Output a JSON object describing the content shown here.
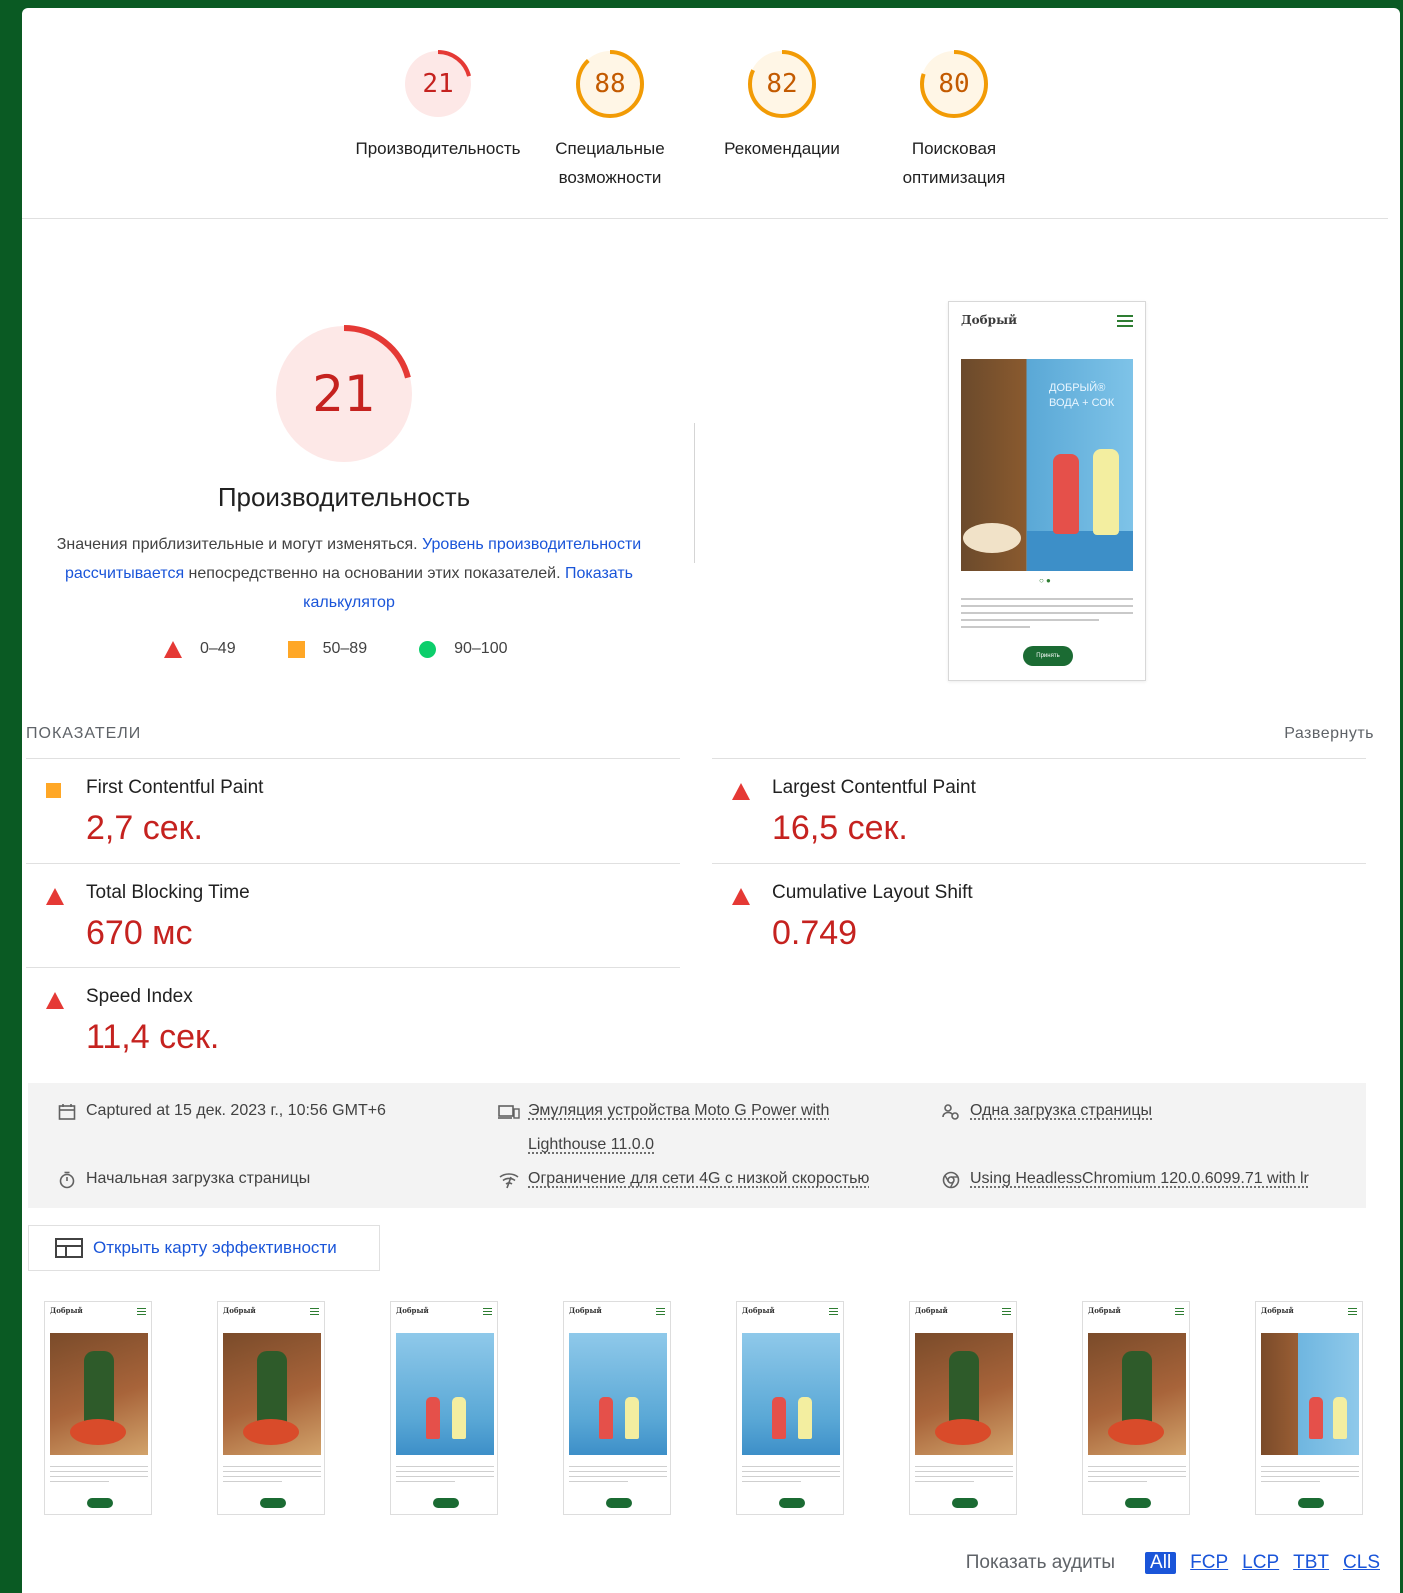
{
  "colors": {
    "fail": "#c5221f",
    "average": "#e67700",
    "pass": "#0cce6b",
    "link": "#1a55d9",
    "brand": "#0a5a23"
  },
  "gauges": [
    {
      "score": 21,
      "label": "Производительность",
      "status": "fail"
    },
    {
      "score": 88,
      "label": "Специальные возможности",
      "status": "average"
    },
    {
      "score": 82,
      "label": "Рекомендации",
      "status": "average"
    },
    {
      "score": 80,
      "label": "Поисковая оптимизация",
      "status": "average"
    }
  ],
  "performance": {
    "score": 21,
    "title": "Производительность",
    "desc_text1": "Значения приблизительные и могут изменяться. ",
    "desc_link1": "Уровень производительности рассчитывается",
    "desc_text2": " непосредственно на основании этих показателей. ",
    "desc_link2": "Показать калькулятор"
  },
  "legend": [
    {
      "icon": "triangle-red-icon",
      "range": "0–49"
    },
    {
      "icon": "square-orange-icon",
      "range": "50–89"
    },
    {
      "icon": "circle-green-icon",
      "range": "90–100"
    }
  ],
  "screenshot": {
    "brand": "Добрый",
    "banner_title": "ДОБРЫЙ® ВОДА + СОК",
    "accept": "Принять"
  },
  "metrics": {
    "header": "ПОКАЗАТЕЛИ",
    "expand": "Развернуть",
    "items": [
      {
        "name": "First Contentful Paint",
        "value": "2,7 сек.",
        "status": "average"
      },
      {
        "name": "Largest Contentful Paint",
        "value": "16,5 сек.",
        "status": "fail"
      },
      {
        "name": "Total Blocking Time",
        "value": "670 мс",
        "status": "fail"
      },
      {
        "name": "Cumulative Layout Shift",
        "value": "0.749",
        "status": "fail"
      },
      {
        "name": "Speed Index",
        "value": "11,4 сек.",
        "status": "fail"
      }
    ]
  },
  "runtime": {
    "captured": "Captured at 15 дек. 2023 г., 10:56 GMT+6",
    "emulation_line1": "Эмуляция устройства Moto G Power with",
    "emulation_line2": "Lighthouse 11.0.0",
    "single_load": "Одна загрузка страницы",
    "initial_load": "Начальная загрузка страницы",
    "throttling": "Ограничение для сети 4G с низкой скоростью",
    "browser": "Using HeadlessChromium 120.0.6099.71 with lr"
  },
  "treemap": {
    "label": "Открыть карту эффективности",
    "icon": "treemap-icon"
  },
  "filmstrip": {
    "brand": "Добрый",
    "frames": [
      "brown",
      "brown",
      "blue",
      "blue",
      "blue",
      "brown",
      "brown",
      "mix"
    ]
  },
  "audits": {
    "label": "Показать аудиты",
    "filters": [
      "All",
      "FCP",
      "LCP",
      "TBT",
      "CLS"
    ],
    "active": "All"
  }
}
